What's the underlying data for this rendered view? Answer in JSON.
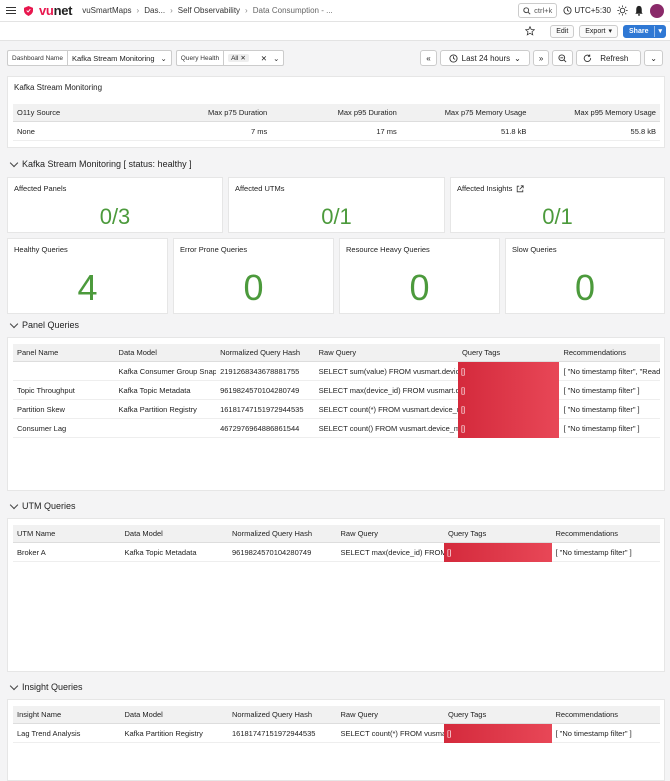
{
  "topbar": {
    "logo_main": "vu",
    "logo_accent": "net",
    "breadcrumb": [
      "vuSmartMaps",
      "Das...",
      "Self Observability",
      "Data Consumption - ..."
    ],
    "search_hint": "ctrl+k",
    "timezone": "UTC+5:30"
  },
  "subbar": {
    "edit": "Edit",
    "export": "Export",
    "share": "Share"
  },
  "filters": {
    "dashboard_label": "Dashboard Name",
    "dashboard_value": "Kafka Stream Monitoring",
    "health_label": "Query Health",
    "health_chip": "All",
    "time_range": "Last 24 hours",
    "refresh": "Refresh"
  },
  "summary": {
    "title": "Kafka Stream Monitoring",
    "headers": [
      "O11y Source",
      "Max p75 Duration",
      "Max p95 Duration",
      "Max p75 Memory Usage",
      "Max p95 Memory Usage"
    ],
    "row": [
      "None",
      "7 ms",
      "17 ms",
      "51.8 kB",
      "55.8 kB"
    ]
  },
  "status_section": {
    "title": "Kafka Stream Monitoring [ status: healthy ]"
  },
  "affected": [
    {
      "label": "Affected Panels",
      "value": "0/3"
    },
    {
      "label": "Affected UTMs",
      "value": "0/1"
    },
    {
      "label": "Affected Insights",
      "value": "0/1"
    }
  ],
  "counts": [
    {
      "label": "Healthy Queries",
      "value": "4"
    },
    {
      "label": "Error Prone Queries",
      "value": "0"
    },
    {
      "label": "Resource Heavy Queries",
      "value": "0"
    },
    {
      "label": "Slow Queries",
      "value": "0"
    }
  ],
  "panel_queries": {
    "title": "Panel Queries",
    "headers": [
      "Panel Name",
      "Data Model",
      "Normalized Query Hash",
      "Raw Query",
      "Query Tags",
      "Recommendations"
    ],
    "rows": [
      [
        "",
        "Kafka Consumer Group Snapshot",
        "2191268343678881755",
        "SELECT sum(value) FROM vusmart.device_metrics",
        "[]",
        "[ \"No timestamp filter\", \"Read"
      ],
      [
        "Topic Throughput",
        "Kafka Topic Metadata",
        "9619824570104280749",
        "SELECT max(device_id) FROM vusmart.device",
        "[]",
        "[ \"No timestamp filter\" ]"
      ],
      [
        "Partition Skew",
        "Kafka Partition Registry",
        "16181747151972944535",
        "SELECT count(*) FROM vusmart.device_metrics",
        "[]",
        "[ \"No timestamp filter\" ]"
      ],
      [
        "Consumer Lag",
        "",
        "4672976964886861544",
        "SELECT count() FROM vusmart.device_metrics",
        "[]",
        "[ \"No timestamp filter\" ]"
      ]
    ]
  },
  "utm_queries": {
    "title": "UTM Queries",
    "headers": [
      "UTM Name",
      "Data Model",
      "Normalized Query Hash",
      "Raw Query",
      "Query Tags",
      "Recommendations"
    ],
    "rows": [
      [
        "Broker A",
        "Kafka Topic Metadata",
        "9619824570104280749",
        "SELECT max(device_id) FROM vusmart",
        "[]",
        "[ \"No timestamp filter\" ]"
      ]
    ]
  },
  "insight_queries": {
    "title": "Insight Queries",
    "headers": [
      "Insight Name",
      "Data Model",
      "Normalized Query Hash",
      "Raw Query",
      "Query Tags",
      "Recommendations"
    ],
    "rows": [
      [
        "Lag Trend Analysis",
        "Kafka Partition Registry",
        "16181747151972944535",
        "SELECT count(*) FROM vusmart",
        "[]",
        "[ \"No timestamp filter\" ]"
      ]
    ]
  },
  "colors": {
    "brand": "#e8174e",
    "healthy": "#4c9a3c",
    "tag": "#d42a3c",
    "primary": "#2f78d4"
  }
}
